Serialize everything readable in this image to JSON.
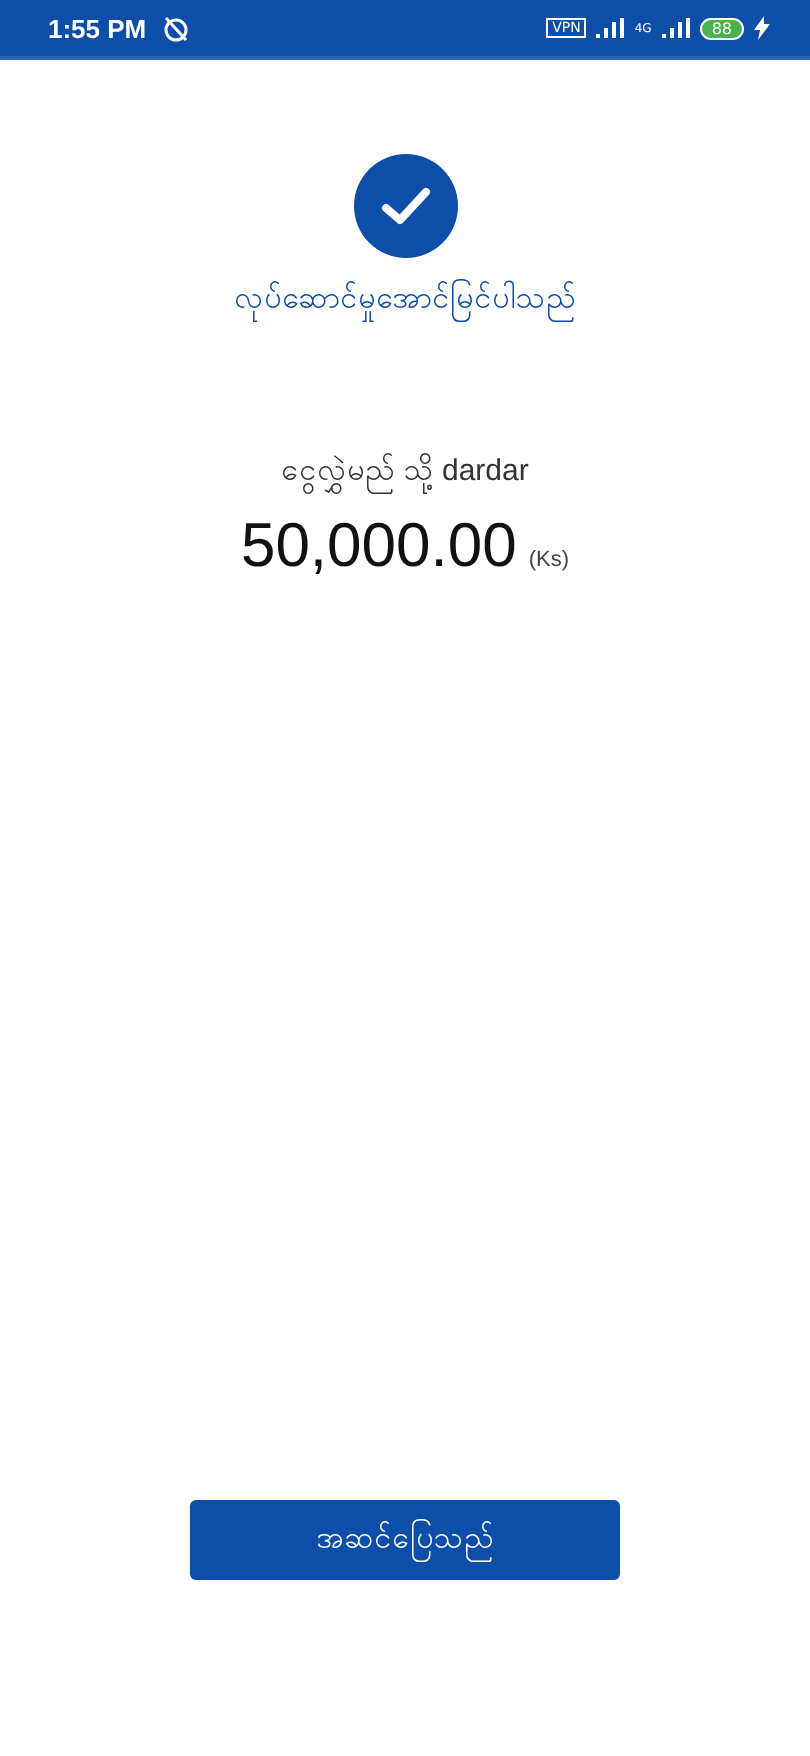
{
  "status_bar": {
    "time": "1:55 PM",
    "vpn": "VPN",
    "network": "4G",
    "battery": "88",
    "charging": true
  },
  "result": {
    "title": "လုပ်ဆောင်မှုအောင်မြင်ပါသည်",
    "recipient": "ငွေလွှဲမည် သို့ dardar",
    "amount": "50,000.00",
    "currency": "(Ks)"
  },
  "buttons": [
    "အဆင်ပြေသည်"
  ]
}
